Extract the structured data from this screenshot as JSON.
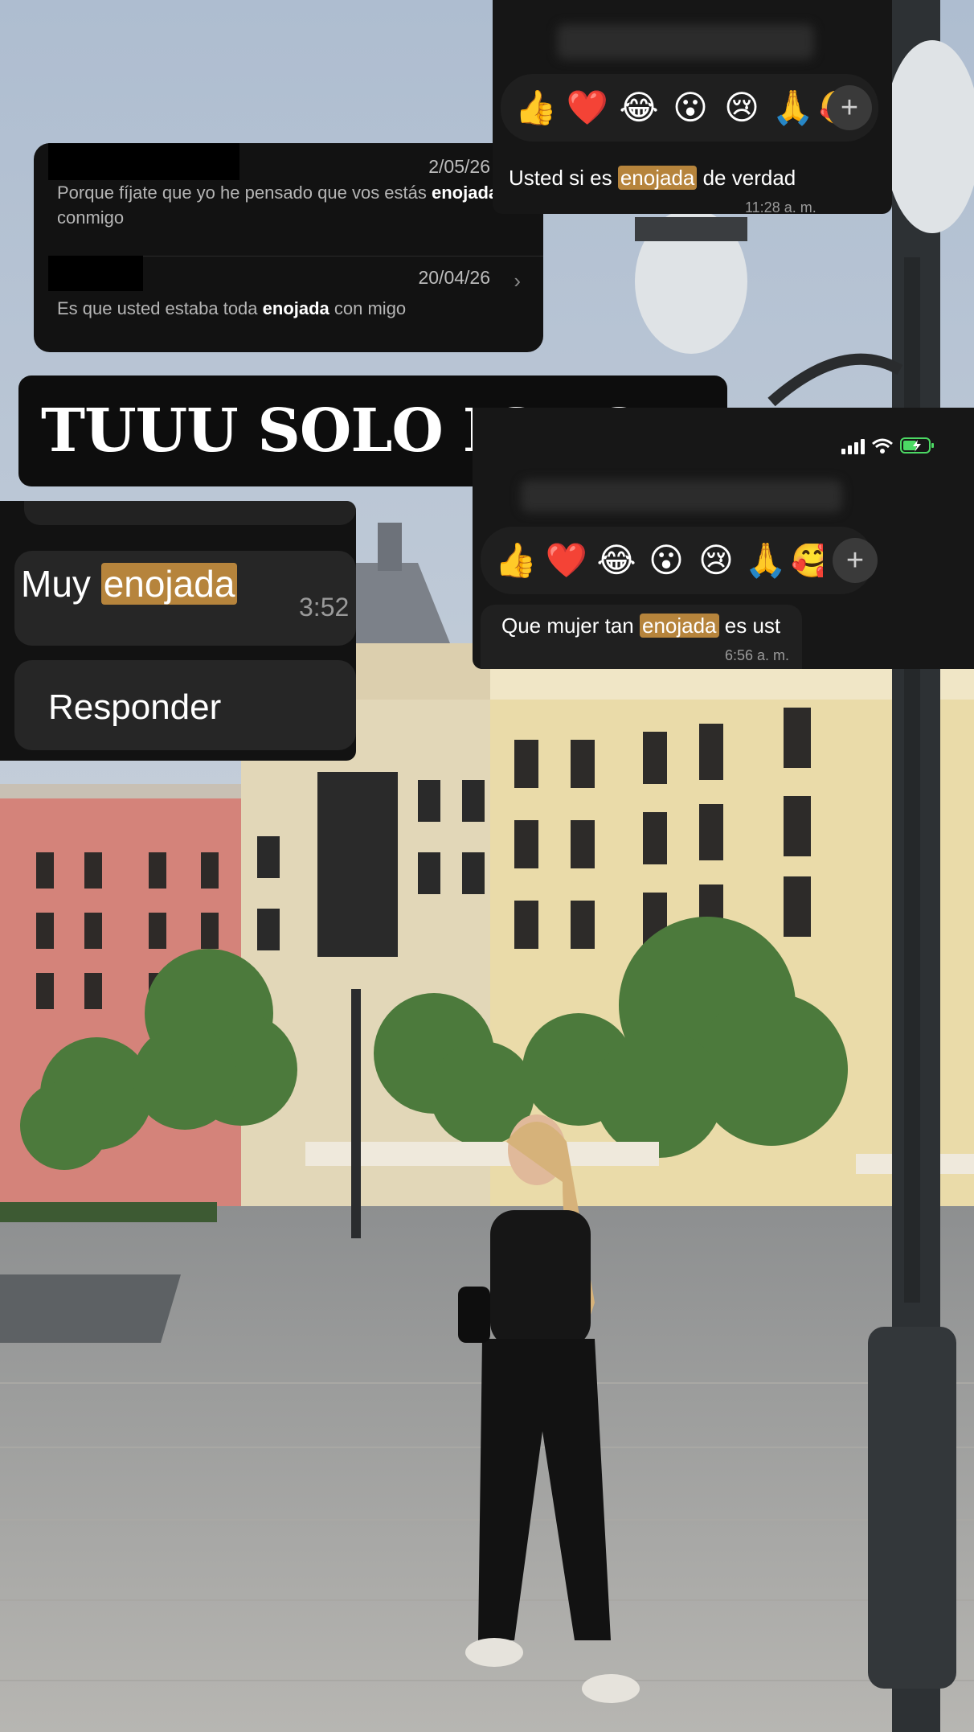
{
  "search_results": [
    {
      "date": "2/05/26",
      "snippet_pre": "Porque fíjate que yo he pensado que vos estás ",
      "snippet_match": "enojada",
      "snippet_post": " conmigo"
    },
    {
      "date": "20/04/26",
      "snippet_pre": "Es que usted estaba toda ",
      "snippet_match": "enojada",
      "snippet_post": " con migo"
    }
  ],
  "reaction_top": {
    "emojis": [
      "👍",
      "❤️",
      "😂",
      "😮",
      "😢",
      "🙏",
      "🥰"
    ],
    "plus_label": "+",
    "message_pre": "Usted si es ",
    "message_match": "enojada",
    "message_post": " de verdad",
    "time": "11:28 a. m."
  },
  "headline": "TUUU SOLO IGNORA!!",
  "left_card": {
    "message_pre": "Muy ",
    "message_match": "enojada",
    "time": "3:52",
    "reply_label": "Responder"
  },
  "reaction_right": {
    "emojis": [
      "👍",
      "❤️",
      "😂",
      "😮",
      "😢",
      "🙏",
      "🥰"
    ],
    "plus_label": "+",
    "message_pre": "Que mujer tan ",
    "message_match": "enojada",
    "message_post": " es ust",
    "time": "6:56 a. m."
  },
  "colors": {
    "highlight": "#b6843c",
    "card_bg": "#141414",
    "battery": "#4cd964"
  }
}
